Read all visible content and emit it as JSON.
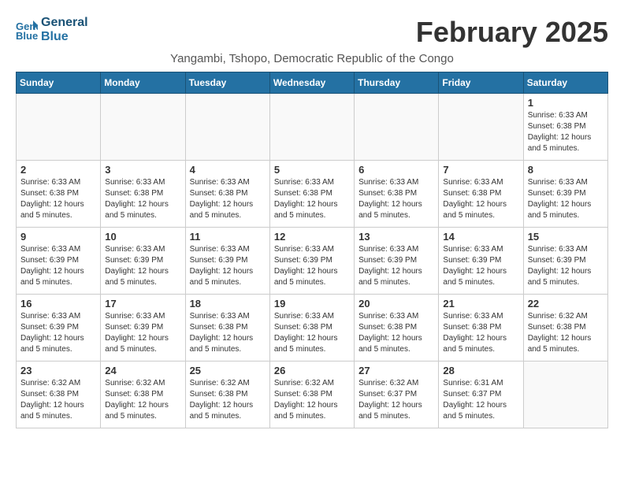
{
  "header": {
    "logo_line1": "General",
    "logo_line2": "Blue",
    "month_title": "February 2025",
    "location": "Yangambi, Tshopo, Democratic Republic of the Congo"
  },
  "weekdays": [
    "Sunday",
    "Monday",
    "Tuesday",
    "Wednesday",
    "Thursday",
    "Friday",
    "Saturday"
  ],
  "weeks": [
    [
      {
        "day": "",
        "info": ""
      },
      {
        "day": "",
        "info": ""
      },
      {
        "day": "",
        "info": ""
      },
      {
        "day": "",
        "info": ""
      },
      {
        "day": "",
        "info": ""
      },
      {
        "day": "",
        "info": ""
      },
      {
        "day": "1",
        "info": "Sunrise: 6:33 AM\nSunset: 6:38 PM\nDaylight: 12 hours and 5 minutes."
      }
    ],
    [
      {
        "day": "2",
        "info": "Sunrise: 6:33 AM\nSunset: 6:38 PM\nDaylight: 12 hours and 5 minutes."
      },
      {
        "day": "3",
        "info": "Sunrise: 6:33 AM\nSunset: 6:38 PM\nDaylight: 12 hours and 5 minutes."
      },
      {
        "day": "4",
        "info": "Sunrise: 6:33 AM\nSunset: 6:38 PM\nDaylight: 12 hours and 5 minutes."
      },
      {
        "day": "5",
        "info": "Sunrise: 6:33 AM\nSunset: 6:38 PM\nDaylight: 12 hours and 5 minutes."
      },
      {
        "day": "6",
        "info": "Sunrise: 6:33 AM\nSunset: 6:38 PM\nDaylight: 12 hours and 5 minutes."
      },
      {
        "day": "7",
        "info": "Sunrise: 6:33 AM\nSunset: 6:38 PM\nDaylight: 12 hours and 5 minutes."
      },
      {
        "day": "8",
        "info": "Sunrise: 6:33 AM\nSunset: 6:39 PM\nDaylight: 12 hours and 5 minutes."
      }
    ],
    [
      {
        "day": "9",
        "info": "Sunrise: 6:33 AM\nSunset: 6:39 PM\nDaylight: 12 hours and 5 minutes."
      },
      {
        "day": "10",
        "info": "Sunrise: 6:33 AM\nSunset: 6:39 PM\nDaylight: 12 hours and 5 minutes."
      },
      {
        "day": "11",
        "info": "Sunrise: 6:33 AM\nSunset: 6:39 PM\nDaylight: 12 hours and 5 minutes."
      },
      {
        "day": "12",
        "info": "Sunrise: 6:33 AM\nSunset: 6:39 PM\nDaylight: 12 hours and 5 minutes."
      },
      {
        "day": "13",
        "info": "Sunrise: 6:33 AM\nSunset: 6:39 PM\nDaylight: 12 hours and 5 minutes."
      },
      {
        "day": "14",
        "info": "Sunrise: 6:33 AM\nSunset: 6:39 PM\nDaylight: 12 hours and 5 minutes."
      },
      {
        "day": "15",
        "info": "Sunrise: 6:33 AM\nSunset: 6:39 PM\nDaylight: 12 hours and 5 minutes."
      }
    ],
    [
      {
        "day": "16",
        "info": "Sunrise: 6:33 AM\nSunset: 6:39 PM\nDaylight: 12 hours and 5 minutes."
      },
      {
        "day": "17",
        "info": "Sunrise: 6:33 AM\nSunset: 6:39 PM\nDaylight: 12 hours and 5 minutes."
      },
      {
        "day": "18",
        "info": "Sunrise: 6:33 AM\nSunset: 6:38 PM\nDaylight: 12 hours and 5 minutes."
      },
      {
        "day": "19",
        "info": "Sunrise: 6:33 AM\nSunset: 6:38 PM\nDaylight: 12 hours and 5 minutes."
      },
      {
        "day": "20",
        "info": "Sunrise: 6:33 AM\nSunset: 6:38 PM\nDaylight: 12 hours and 5 minutes."
      },
      {
        "day": "21",
        "info": "Sunrise: 6:33 AM\nSunset: 6:38 PM\nDaylight: 12 hours and 5 minutes."
      },
      {
        "day": "22",
        "info": "Sunrise: 6:32 AM\nSunset: 6:38 PM\nDaylight: 12 hours and 5 minutes."
      }
    ],
    [
      {
        "day": "23",
        "info": "Sunrise: 6:32 AM\nSunset: 6:38 PM\nDaylight: 12 hours and 5 minutes."
      },
      {
        "day": "24",
        "info": "Sunrise: 6:32 AM\nSunset: 6:38 PM\nDaylight: 12 hours and 5 minutes."
      },
      {
        "day": "25",
        "info": "Sunrise: 6:32 AM\nSunset: 6:38 PM\nDaylight: 12 hours and 5 minutes."
      },
      {
        "day": "26",
        "info": "Sunrise: 6:32 AM\nSunset: 6:38 PM\nDaylight: 12 hours and 5 minutes."
      },
      {
        "day": "27",
        "info": "Sunrise: 6:32 AM\nSunset: 6:37 PM\nDaylight: 12 hours and 5 minutes."
      },
      {
        "day": "28",
        "info": "Sunrise: 6:31 AM\nSunset: 6:37 PM\nDaylight: 12 hours and 5 minutes."
      },
      {
        "day": "",
        "info": ""
      }
    ]
  ]
}
